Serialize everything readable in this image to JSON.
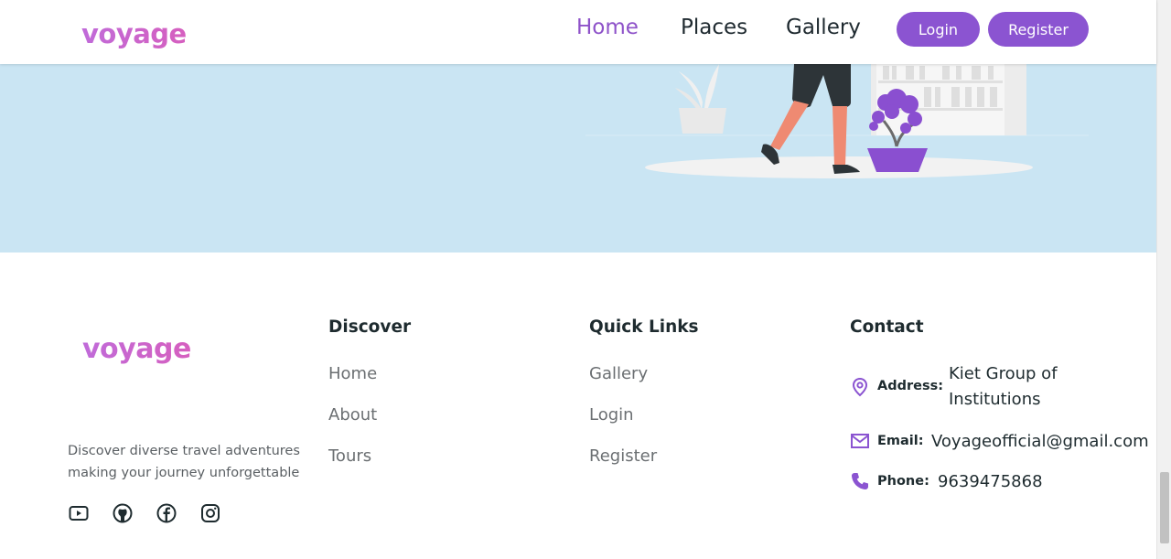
{
  "colors": {
    "accent": "#8b54d1",
    "brand_logo": "#c565d2",
    "hero_bg": "#cae5f3",
    "text_dark": "#1e2b2f",
    "text_muted": "#6b6f72"
  },
  "navbar": {
    "logo": "voyage",
    "links": [
      "Home",
      "Places",
      "Gallery"
    ],
    "active_link": "Home",
    "login_label": "Login",
    "register_label": "Register"
  },
  "hero": {
    "illustration": "person-walking-with-plants-illustration"
  },
  "footer": {
    "logo": "voyage",
    "tagline_line1": "Discover diverse travel adventures",
    "tagline_line2": "making your journey unforgettable",
    "social_icons": [
      "youtube-icon",
      "github-icon",
      "facebook-icon",
      "instagram-icon"
    ],
    "discover": {
      "title": "Discover",
      "links": [
        "Home",
        "About",
        "Tours"
      ]
    },
    "quick_links": {
      "title": "Quick Links",
      "links": [
        "Gallery",
        "Login",
        "Register"
      ]
    },
    "contact": {
      "title": "Contact",
      "address_label": "Address:",
      "address_line1": "Kiet Group of",
      "address_line2": "Institutions",
      "email_label": "Email:",
      "email": "Voyageofficial@gmail.com",
      "phone_label": "Phone:",
      "phone": "9639475868"
    }
  }
}
